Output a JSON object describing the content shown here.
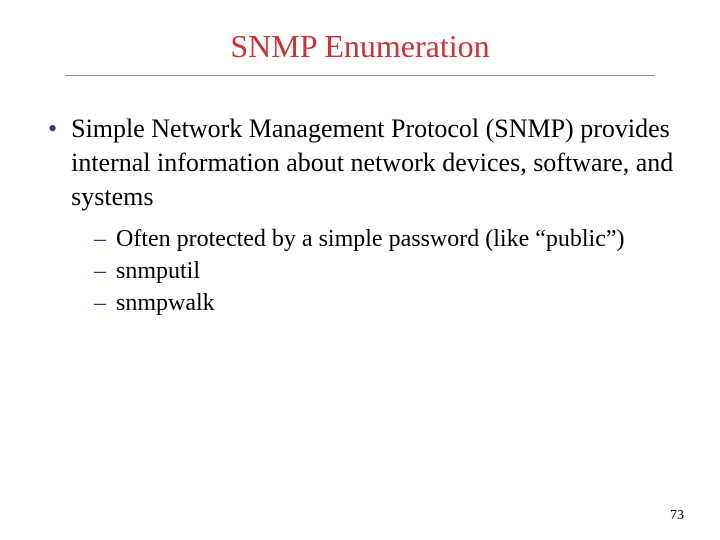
{
  "title": "SNMP Enumeration",
  "bullets": [
    {
      "text": "Simple Network Management Protocol (SNMP) provides internal information about network devices, software, and systems",
      "subs": [
        "Often protected by a simple password (like “public”)",
        "snmputil",
        "snmpwalk"
      ]
    }
  ],
  "pageNumber": "73"
}
